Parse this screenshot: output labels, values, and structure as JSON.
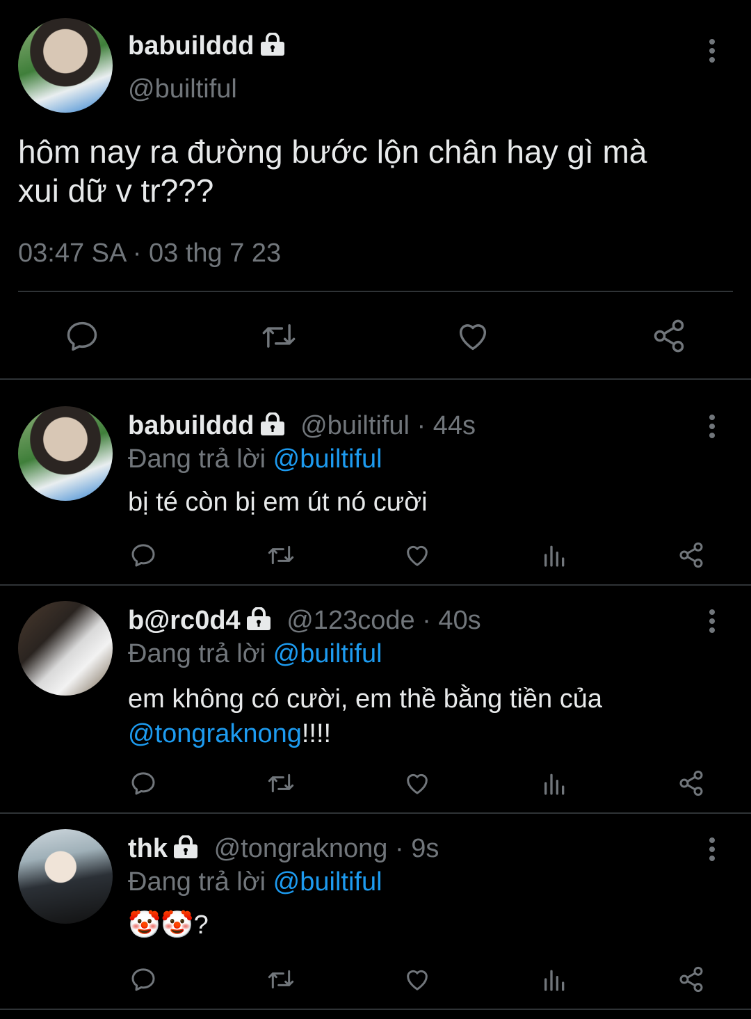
{
  "main_tweet": {
    "display_name": "babuilddd",
    "handle": "@builtiful",
    "text_line1": "hôm nay ra đường bước lộn chân hay gì mà",
    "text_line2": "xui dữ v tr???",
    "timestamp": "03:47 SA · 03 thg 7 23"
  },
  "replies": [
    {
      "display_name": "babuilddd",
      "meta": "@builtiful · 44s",
      "replying_prefix": "Đang trả lời",
      "replying_to": "@builtiful",
      "text": "bị té còn bị em út nó cười"
    },
    {
      "display_name": "b@rc0d4",
      "meta": "@123code · 40s",
      "replying_prefix": "Đang trả lời",
      "replying_to": "@builtiful",
      "text_line1": "em không có cười, em thề bằng tiền của",
      "mention": "@tongraknong",
      "text_suffix": "!!!!"
    },
    {
      "display_name": "thk",
      "meta": "@tongraknong · 9s",
      "replying_prefix": "Đang trả lời",
      "replying_to": "@builtiful",
      "text": "🤡🤡?"
    }
  ],
  "colors": {
    "background": "#000000",
    "text": "#e7e9ea",
    "muted": "#71767b",
    "link": "#1d9bf0",
    "divider": "#2f3336"
  },
  "icons": [
    "lock-icon",
    "more-icon",
    "reply-icon",
    "retweet-icon",
    "like-icon",
    "views-icon",
    "share-icon"
  ]
}
